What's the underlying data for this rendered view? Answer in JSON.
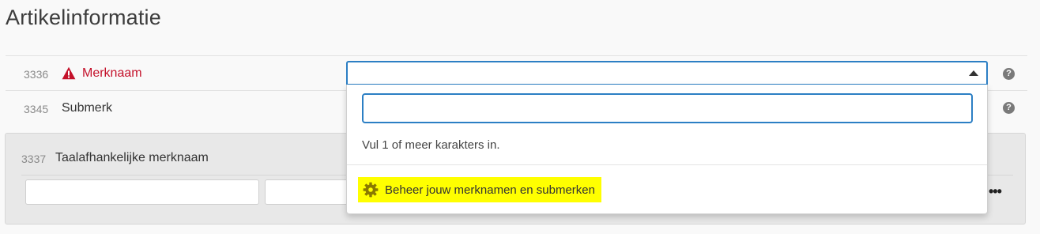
{
  "page": {
    "title": "Artikelinformatie"
  },
  "fields": [
    {
      "id": "3336",
      "label": "Merknaam",
      "status": "error"
    },
    {
      "id": "3345",
      "label": "Submerk",
      "status": "normal"
    }
  ],
  "language_panel": {
    "id": "3337",
    "label": "Taalafhankelijke merknaam"
  },
  "dropdown": {
    "search_value": "",
    "hint": "Vul 1 of meer karakters in.",
    "manage_label": "Beheer jouw merknamen en submerken"
  },
  "icons": {
    "warning": "warning-triangle-icon",
    "help": "question-circle-icon",
    "gear": "gear-icon",
    "arrow": "caret-up-icon",
    "more": "ellipsis-icon"
  },
  "colors": {
    "error": "#c4112a",
    "focus_border": "#2c7fc4",
    "highlight": "#ffff00"
  }
}
